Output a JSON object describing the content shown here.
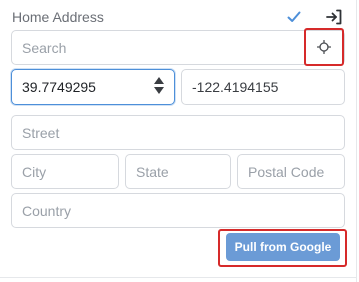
{
  "header": {
    "title": "Home Address",
    "confirm_icon": "check-icon",
    "exit_icon": "exit-arrow-icon",
    "accent_color": "#4d8fd9"
  },
  "search": {
    "placeholder": "Search",
    "locate_icon": "crosshair-icon"
  },
  "coordinates": {
    "latitude": "39.7749295",
    "longitude": "-122.4194155"
  },
  "address": {
    "street_placeholder": "Street",
    "city_placeholder": "City",
    "state_placeholder": "State",
    "postal_placeholder": "Postal Code",
    "country_placeholder": "Country"
  },
  "actions": {
    "pull_label": "Pull from Google",
    "pull_color": "#6b9bd6",
    "highlight_color": "#d62a2a"
  }
}
